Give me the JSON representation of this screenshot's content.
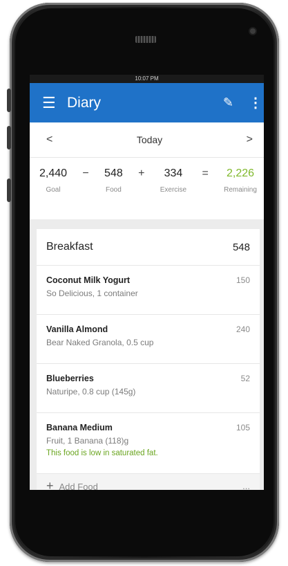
{
  "status_bar": {
    "time": "10:07 PM"
  },
  "app_bar": {
    "menu_icon": "hamburger-icon",
    "title": "Diary",
    "edit_icon": "pencil-icon",
    "more_icon": "kebab-icon"
  },
  "date_nav": {
    "prev": "<",
    "label": "Today",
    "next": ">"
  },
  "summary": {
    "goal": {
      "value": "2,440",
      "label": "Goal"
    },
    "op1": "−",
    "food": {
      "value": "548",
      "label": "Food"
    },
    "op2": "+",
    "exercise": {
      "value": "334",
      "label": "Exercise"
    },
    "op3": "=",
    "remaining": {
      "value": "2,226",
      "label": "Remaining"
    }
  },
  "meal": {
    "name": "Breakfast",
    "calories": "548",
    "items": [
      {
        "name": "Coconut Milk Yogurt",
        "desc": "So Delicious, 1 container",
        "cal": "150"
      },
      {
        "name": "Vanilla Almond",
        "desc": "Bear Naked Granola, 0.5 cup",
        "cal": "240"
      },
      {
        "name": "Blueberries",
        "desc": "Naturipe, 0.8 cup (145g)",
        "cal": "52"
      },
      {
        "name": "Banana Medium",
        "desc": "Fruit, 1 Banana (118)g",
        "cal": "105",
        "note": "This food is low in saturated fat."
      }
    ],
    "add_food": "Add Food",
    "add_more": "..."
  },
  "colors": {
    "app_bar": "#1f72c8",
    "remaining": "#7fb82b",
    "note": "#6aa51f"
  }
}
